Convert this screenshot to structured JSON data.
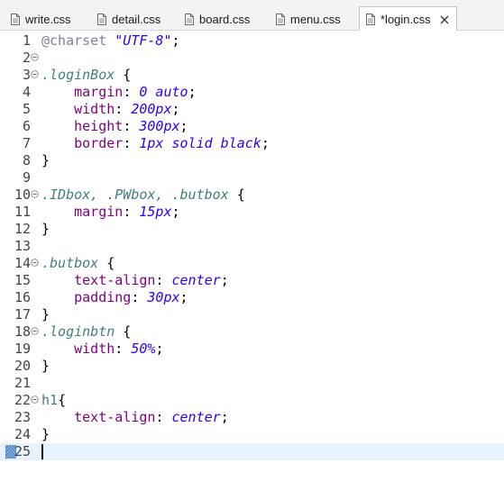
{
  "tabs": [
    {
      "label": "write.css",
      "active": false
    },
    {
      "label": "detail.css",
      "active": false
    },
    {
      "label": "board.css",
      "active": false
    },
    {
      "label": "menu.css",
      "active": false
    },
    {
      "label": "*login.css",
      "active": true
    }
  ],
  "icons": {
    "tab_file": "css-file-icon",
    "tab_close": "close-icon",
    "fold": "fold-collapse-icon",
    "bookmark": "current-line-marker-icon"
  },
  "colors": {
    "selector": "#3f7f7f",
    "property": "#7f007f",
    "value": "#2a00ff",
    "at_rule": "#7f7f9f",
    "current_line": "#e8f2fe"
  },
  "current_line": 25,
  "lines": [
    {
      "num": "1",
      "fold": false,
      "tokens": [
        {
          "t": "kw",
          "v": "@charset "
        },
        {
          "t": "str",
          "v": "\"UTF-8\""
        },
        {
          "t": "pl",
          "v": ";"
        }
      ]
    },
    {
      "num": "2",
      "fold": true,
      "tokens": []
    },
    {
      "num": "3",
      "fold": true,
      "tokens": [
        {
          "t": "sel",
          "v": ".loginBox"
        },
        {
          "t": "pl",
          "v": " {"
        }
      ]
    },
    {
      "num": "4",
      "fold": false,
      "tokens": [
        {
          "t": "pl",
          "v": "    "
        },
        {
          "t": "prop",
          "v": "margin"
        },
        {
          "t": "pl",
          "v": ": "
        },
        {
          "t": "val",
          "v": "0 auto"
        },
        {
          "t": "pl",
          "v": ";"
        }
      ]
    },
    {
      "num": "5",
      "fold": false,
      "tokens": [
        {
          "t": "pl",
          "v": "    "
        },
        {
          "t": "prop",
          "v": "width"
        },
        {
          "t": "pl",
          "v": ": "
        },
        {
          "t": "val",
          "v": "200px"
        },
        {
          "t": "pl",
          "v": ";"
        }
      ]
    },
    {
      "num": "6",
      "fold": false,
      "tokens": [
        {
          "t": "pl",
          "v": "    "
        },
        {
          "t": "prop",
          "v": "height"
        },
        {
          "t": "pl",
          "v": ": "
        },
        {
          "t": "val",
          "v": "300px"
        },
        {
          "t": "pl",
          "v": ";"
        }
      ]
    },
    {
      "num": "7",
      "fold": false,
      "tokens": [
        {
          "t": "pl",
          "v": "    "
        },
        {
          "t": "prop",
          "v": "border"
        },
        {
          "t": "pl",
          "v": ": "
        },
        {
          "t": "val",
          "v": "1px solid black"
        },
        {
          "t": "pl",
          "v": ";"
        }
      ]
    },
    {
      "num": "8",
      "fold": false,
      "tokens": [
        {
          "t": "pl",
          "v": "}"
        }
      ]
    },
    {
      "num": "9",
      "fold": false,
      "tokens": []
    },
    {
      "num": "10",
      "fold": true,
      "tokens": [
        {
          "t": "sel",
          "v": ".IDbox, .PWbox, .butbox"
        },
        {
          "t": "pl",
          "v": " {"
        }
      ]
    },
    {
      "num": "11",
      "fold": false,
      "tokens": [
        {
          "t": "pl",
          "v": "    "
        },
        {
          "t": "prop",
          "v": "margin"
        },
        {
          "t": "pl",
          "v": ": "
        },
        {
          "t": "val",
          "v": "15px"
        },
        {
          "t": "pl",
          "v": ";"
        }
      ]
    },
    {
      "num": "12",
      "fold": false,
      "tokens": [
        {
          "t": "pl",
          "v": "}"
        }
      ]
    },
    {
      "num": "13",
      "fold": false,
      "tokens": []
    },
    {
      "num": "14",
      "fold": true,
      "tokens": [
        {
          "t": "sel",
          "v": ".butbox"
        },
        {
          "t": "pl",
          "v": " {"
        }
      ]
    },
    {
      "num": "15",
      "fold": false,
      "tokens": [
        {
          "t": "pl",
          "v": "    "
        },
        {
          "t": "prop",
          "v": "text-align"
        },
        {
          "t": "pl",
          "v": ": "
        },
        {
          "t": "val",
          "v": "center"
        },
        {
          "t": "pl",
          "v": ";"
        }
      ]
    },
    {
      "num": "16",
      "fold": false,
      "tokens": [
        {
          "t": "pl",
          "v": "    "
        },
        {
          "t": "prop",
          "v": "padding"
        },
        {
          "t": "pl",
          "v": ": "
        },
        {
          "t": "val",
          "v": "30px"
        },
        {
          "t": "pl",
          "v": ";"
        }
      ]
    },
    {
      "num": "17",
      "fold": false,
      "tokens": [
        {
          "t": "pl",
          "v": "}"
        }
      ]
    },
    {
      "num": "18",
      "fold": true,
      "tokens": [
        {
          "t": "sel",
          "v": ".loginbtn"
        },
        {
          "t": "pl",
          "v": " {"
        }
      ]
    },
    {
      "num": "19",
      "fold": false,
      "tokens": [
        {
          "t": "pl",
          "v": "    "
        },
        {
          "t": "prop",
          "v": "width"
        },
        {
          "t": "pl",
          "v": ": "
        },
        {
          "t": "val",
          "v": "50%"
        },
        {
          "t": "pl",
          "v": ";"
        }
      ]
    },
    {
      "num": "20",
      "fold": false,
      "tokens": [
        {
          "t": "pl",
          "v": "}"
        }
      ]
    },
    {
      "num": "21",
      "fold": false,
      "tokens": []
    },
    {
      "num": "22",
      "fold": true,
      "tokens": [
        {
          "t": "sel-plain",
          "v": "h1"
        },
        {
          "t": "pl",
          "v": "{"
        }
      ]
    },
    {
      "num": "23",
      "fold": false,
      "tokens": [
        {
          "t": "pl",
          "v": "    "
        },
        {
          "t": "prop",
          "v": "text-align"
        },
        {
          "t": "pl",
          "v": ": "
        },
        {
          "t": "val",
          "v": "center"
        },
        {
          "t": "pl",
          "v": ";"
        }
      ]
    },
    {
      "num": "24",
      "fold": false,
      "tokens": [
        {
          "t": "pl",
          "v": "}"
        }
      ]
    },
    {
      "num": "25",
      "fold": false,
      "tokens": []
    }
  ]
}
